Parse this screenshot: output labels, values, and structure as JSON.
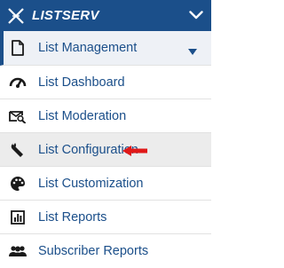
{
  "header": {
    "brand": "LISTSERV",
    "logo_icon": "listserv-logo",
    "collapse_icon": "chevron-down-icon"
  },
  "menu": {
    "section": {
      "label": "List Management",
      "icon": "document-icon",
      "dropdown_icon": "triangle-down-icon"
    },
    "items": [
      {
        "label": "List Dashboard",
        "icon": "gauge-icon"
      },
      {
        "label": "List Moderation",
        "icon": "moderation-search-icon"
      },
      {
        "label": "List Configuration",
        "icon": "wrench-icon",
        "highlighted": true
      },
      {
        "label": "List Customization",
        "icon": "palette-icon"
      },
      {
        "label": "List Reports",
        "icon": "report-chart-icon"
      },
      {
        "label": "Subscriber Reports",
        "icon": "users-icon"
      }
    ]
  },
  "annotation": {
    "arrow_color": "#e01919"
  },
  "colors": {
    "brand_blue": "#1b4f8a",
    "highlight_bg": "#ececec"
  }
}
